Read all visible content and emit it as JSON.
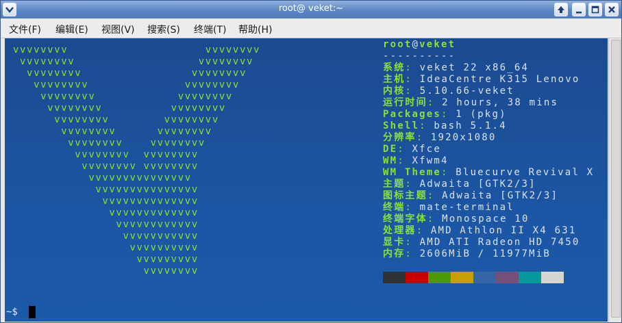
{
  "window": {
    "title": "root@ veket:~"
  },
  "menubar": {
    "items": [
      "文件(F)",
      "编辑(E)",
      "视图(V)",
      "搜索(S)",
      "终端(T)",
      "帮助(H)"
    ]
  },
  "terminal": {
    "logo_lines": [
      "vvvvvvvv                    vvvvvvvv",
      " vvvvvvvv                  vvvvvvvv",
      "  vvvvvvvv                vvvvvvvv",
      "   vvvvvvvv              vvvvvvvv",
      "    vvvvvvvv            vvvvvvvv",
      "     vvvvvvvv          vvvvvvvv",
      "      vvvvvvvv        vvvvvvvv",
      "       vvvvvvvv      vvvvvvvv",
      "        vvvvvvvv    vvvvvvvv",
      "         vvvvvvvv  vvvvvvvv",
      "          vvvvvvvv vvvvvvvv",
      "           vvvvvvvvvvvvvvv",
      "            vvvvvvvvvvvvvvv",
      "             vvvvvvvvvvvvvv",
      "              vvvvvvvvvvvvv",
      "               vvvvvvvvvvvv",
      "                vvvvvvvvvvv",
      "                 vvvvvvvvvv",
      "                  vvvvvvvvv",
      "                   vvvvvvvv"
    ],
    "header_user": "root",
    "header_at": "@",
    "header_host": "veket",
    "separator": "----------",
    "info": [
      {
        "key": "系统",
        "sep": ": ",
        "value": "veket 22 x86_64"
      },
      {
        "key": "主机",
        "sep": ": ",
        "value": "IdeaCentre K315 Lenovo"
      },
      {
        "key": "内核",
        "sep": ": ",
        "value": "5.10.66-veket"
      },
      {
        "key": "运行时间",
        "sep": ": ",
        "value": "2 hours, 38 mins"
      },
      {
        "key": "Packages",
        "sep": ": ",
        "value": "1 (pkg)"
      },
      {
        "key": "Shell",
        "sep": ": ",
        "value": "bash 5.1.4"
      },
      {
        "key": "分辨率",
        "sep": ": ",
        "value": "1920x1080"
      },
      {
        "key": "DE",
        "sep": ": ",
        "value": "Xfce"
      },
      {
        "key": "WM",
        "sep": ": ",
        "value": "Xfwm4"
      },
      {
        "key": "WM Theme",
        "sep": ": ",
        "value": "Bluecurve Revival X"
      },
      {
        "key": "主题",
        "sep": ": ",
        "value": "Adwaita [GTK2/3]"
      },
      {
        "key": "图标主题",
        "sep": ": ",
        "value": "Adwaita [GTK2/3]"
      },
      {
        "key": "终端",
        "sep": ": ",
        "value": "mate-terminal"
      },
      {
        "key": "终端字体",
        "sep": ": ",
        "value": "Monospace 10"
      },
      {
        "key": "处理器",
        "sep": ": ",
        "value": "AMD Athlon II X4 631"
      },
      {
        "key": "显卡",
        "sep": ": ",
        "value": "AMD ATI Radeon HD 7450"
      },
      {
        "key": "内存",
        "sep": ": ",
        "value": "2606MiB / 11977MiB"
      }
    ],
    "palette": [
      "#2e3436",
      "#cc0000",
      "#4e9a06",
      "#c4a000",
      "#3465a4",
      "#75507b",
      "#06989a",
      "#d3d7cf"
    ],
    "prompt": "~$"
  }
}
